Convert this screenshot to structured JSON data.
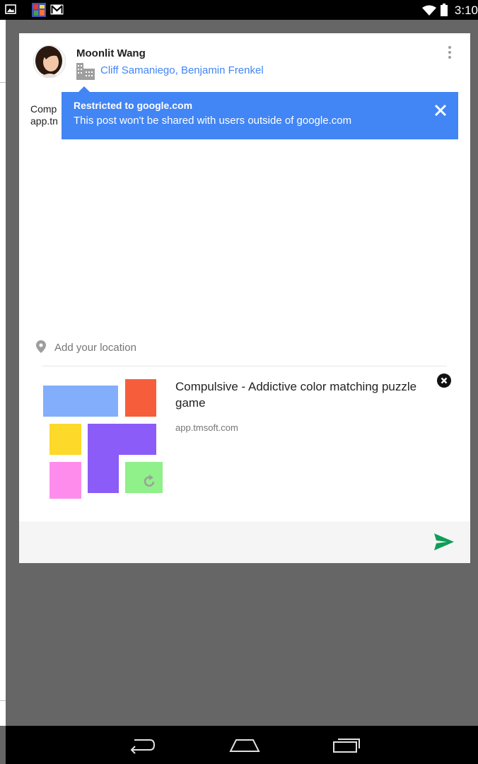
{
  "status_bar": {
    "time": "3:10",
    "icons": [
      "image-icon",
      "game-app-icon",
      "gmail-icon",
      "wifi-icon",
      "battery-icon"
    ]
  },
  "post": {
    "author": "Moonlit Wang",
    "audience": "Cliff Samaniego, Benjamin Frenkel",
    "text_line1": "Comp",
    "text_line2": "app.tn",
    "menu_icon": "overflow-menu-icon"
  },
  "tooltip": {
    "title": "Restricted to google.com",
    "body": "This post won't be shared with users outside of google.com",
    "close_icon": "close-icon"
  },
  "location": {
    "placeholder": "Add your location",
    "icon": "location-pin-icon"
  },
  "link_preview": {
    "title": "Compulsive - Addictive color matching puzzle game",
    "domain": "app.tmsoft.com",
    "remove_icon": "remove-icon"
  },
  "footer": {
    "send_icon": "send-icon"
  },
  "nav": {
    "back": "back-icon",
    "home": "home-icon",
    "recents": "recents-icon"
  },
  "colors": {
    "accent_blue": "#4285f4",
    "send_green": "#0f9d58",
    "backdrop": "#666666"
  }
}
